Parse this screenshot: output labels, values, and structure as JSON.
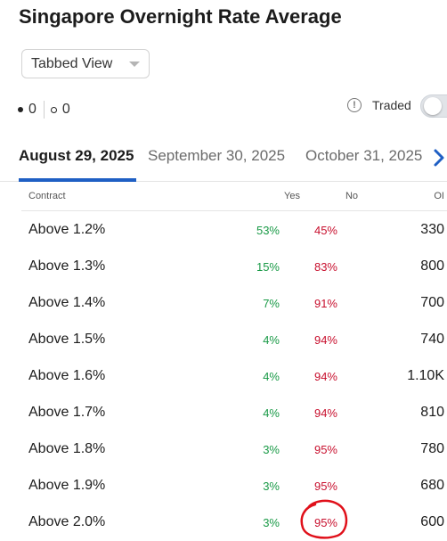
{
  "page": {
    "title": "Singapore Overnight Rate Average"
  },
  "view_select": {
    "value": "Tabbed View",
    "caret_icon": "chevron-down-icon"
  },
  "counts": {
    "filled": "0",
    "open": "0"
  },
  "traded": {
    "label": "Traded",
    "info_icon": "!",
    "toggle_on": false
  },
  "tabs": [
    {
      "label": "August 29, 2025",
      "active": true
    },
    {
      "label": "September 30, 2025",
      "active": false
    },
    {
      "label": "October 31, 2025",
      "active": false
    }
  ],
  "table": {
    "headers": {
      "contract": "Contract",
      "yes": "Yes",
      "no": "No",
      "oi": "OI"
    },
    "rows": [
      {
        "contract": "Above 1.2%",
        "yes": "53%",
        "no": "45%",
        "oi": "330"
      },
      {
        "contract": "Above 1.3%",
        "yes": "15%",
        "no": "83%",
        "oi": "800"
      },
      {
        "contract": "Above 1.4%",
        "yes": "7%",
        "no": "91%",
        "oi": "700"
      },
      {
        "contract": "Above 1.5%",
        "yes": "4%",
        "no": "94%",
        "oi": "740"
      },
      {
        "contract": "Above 1.6%",
        "yes": "4%",
        "no": "94%",
        "oi": "1.10K"
      },
      {
        "contract": "Above 1.7%",
        "yes": "4%",
        "no": "94%",
        "oi": "810"
      },
      {
        "contract": "Above 1.8%",
        "yes": "3%",
        "no": "95%",
        "oi": "780"
      },
      {
        "contract": "Above 1.9%",
        "yes": "3%",
        "no": "95%",
        "oi": "680"
      },
      {
        "contract": "Above 2.0%",
        "yes": "3%",
        "no": "95%",
        "oi": "600"
      }
    ]
  },
  "colors": {
    "yes": "#1a9a47",
    "no": "#c8102e",
    "accent": "#1f5fc4",
    "annotation": "#e0101a"
  }
}
